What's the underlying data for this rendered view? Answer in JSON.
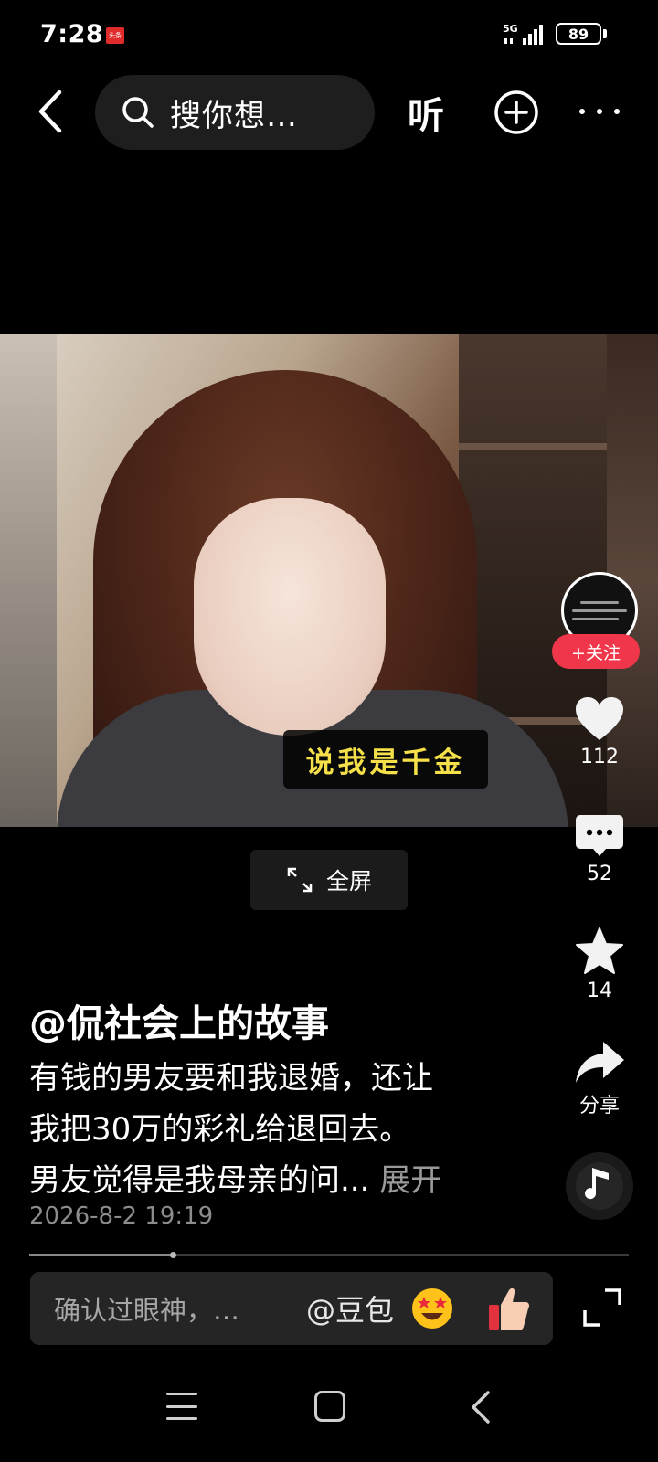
{
  "status_bar": {
    "time": "7:28",
    "app_badge": "头条",
    "network": "5G",
    "battery": "89"
  },
  "top_bar": {
    "search_placeholder": "搜你想…",
    "listen_label": "听"
  },
  "video": {
    "caption": "说我是千金",
    "fullscreen_label": "全屏"
  },
  "side_actions": {
    "follow_label": "+关注",
    "likes": "112",
    "comments": "52",
    "favorites": "14",
    "share_label": "分享"
  },
  "post": {
    "author": "@侃社会上的故事",
    "text_line1": "有钱的男友要和我退婚，还让",
    "text_line2": "我把30万的彩礼给退回去。",
    "text_line3": "男友觉得是我母亲的问...",
    "expand_label": "展开",
    "date": "2026-8-2 19:19"
  },
  "playback": {
    "progress": 0.24
  },
  "comment_bar": {
    "placeholder": "确认过眼神，…",
    "mention": "@豆包"
  },
  "icons": {
    "back": "back-chevron-icon",
    "search": "search-icon",
    "add": "plus-circle-icon",
    "more": "more-dots-icon",
    "like": "heart-icon",
    "comment": "comment-bubble-icon",
    "favorite": "star-icon",
    "share": "share-arrow-icon",
    "music": "music-note-icon"
  },
  "colors": {
    "follow": "#f0364a",
    "caption_text": "#f5e04a",
    "background": "#000000"
  }
}
